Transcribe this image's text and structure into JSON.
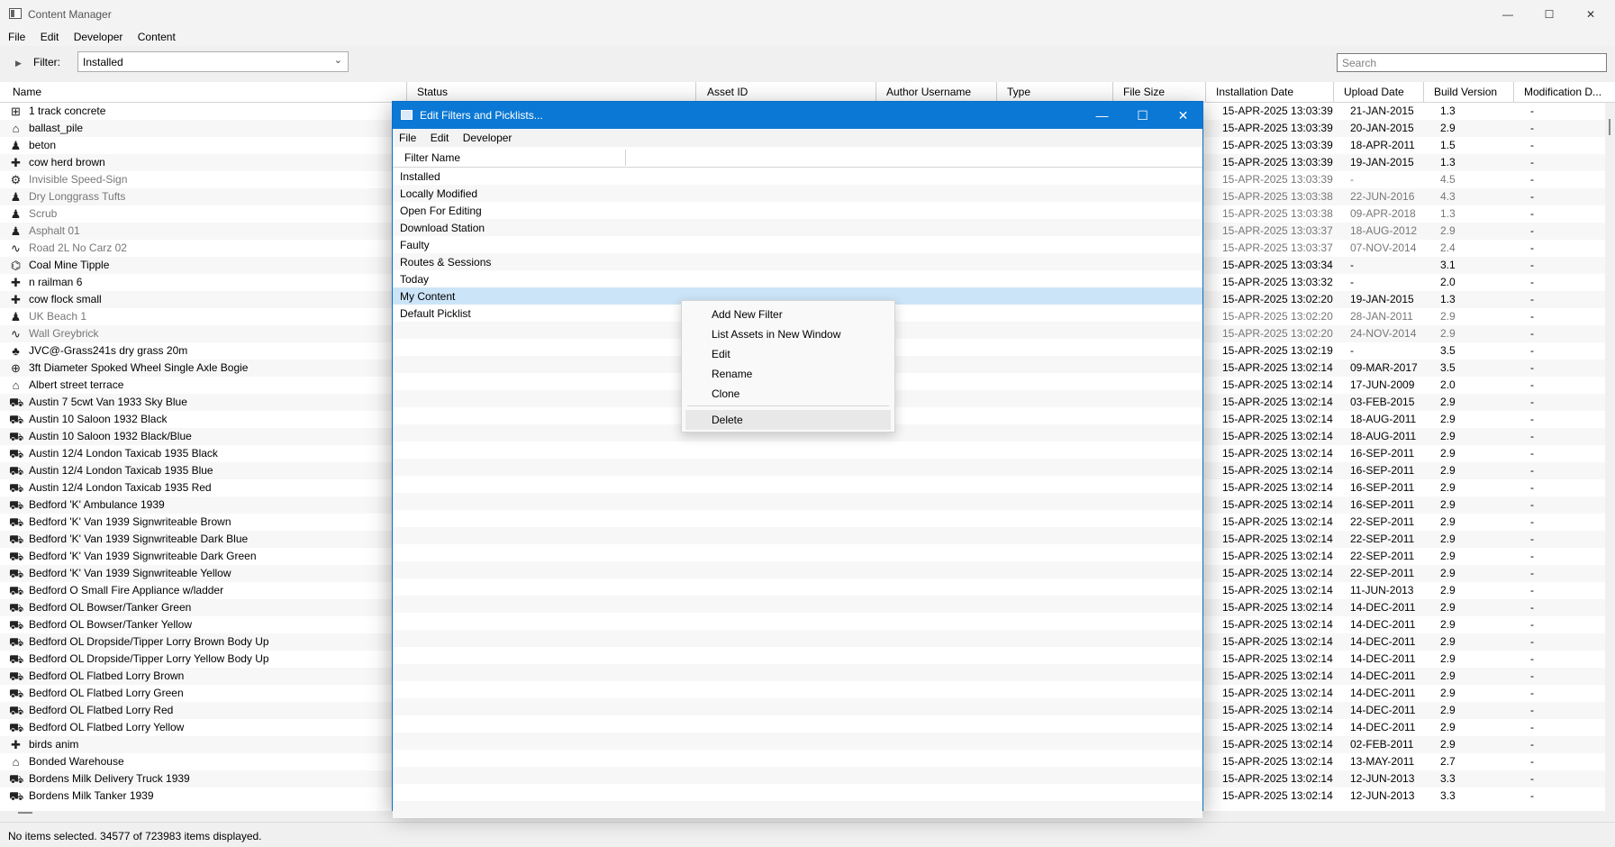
{
  "window": {
    "title": "Content Manager",
    "minimize_glyph": "—",
    "maximize_glyph": "☐",
    "close_glyph": "✕"
  },
  "menu": [
    "File",
    "Edit",
    "Developer",
    "Content"
  ],
  "filter": {
    "expander_glyph": "▶",
    "label": "Filter:",
    "value": "Installed",
    "chevron_glyph": "⌄"
  },
  "search": {
    "placeholder": "Search"
  },
  "columns": [
    "Name",
    "Status",
    "Asset ID",
    "Author Username",
    "Type",
    "File Size",
    "Installation Date",
    "Upload Date",
    "Build Version",
    "Modification D..."
  ],
  "rows": [
    {
      "icon": "track-icon",
      "glyph": "⊞",
      "name": "1 track concrete",
      "inst": "15-APR-2025 13:03:39",
      "upload": "21-JAN-2015",
      "build": "1.3",
      "mod": "-",
      "gray": false
    },
    {
      "icon": "house-icon",
      "glyph": "⌂",
      "name": "ballast_pile",
      "inst": "15-APR-2025 13:03:39",
      "upload": "20-JAN-2015",
      "build": "2.9",
      "mod": "-",
      "gray": false
    },
    {
      "icon": "figure-icon",
      "glyph": "♟",
      "name": "beton",
      "inst": "15-APR-2025 13:03:39",
      "upload": "18-APR-2011",
      "build": "1.5",
      "mod": "-",
      "gray": false
    },
    {
      "icon": "puzzle-icon",
      "glyph": "✚",
      "name": "cow herd brown",
      "inst": "15-APR-2025 13:03:39",
      "upload": "19-JAN-2015",
      "build": "1.3",
      "mod": "-",
      "gray": false
    },
    {
      "icon": "gear-icon",
      "glyph": "⚙",
      "name": "Invisible Speed-Sign",
      "inst": "15-APR-2025 13:03:39",
      "upload": "-",
      "build": "4.5",
      "mod": "-",
      "gray": true
    },
    {
      "icon": "figure-icon",
      "glyph": "♟",
      "name": "Dry Longgrass Tufts",
      "inst": "15-APR-2025 13:03:38",
      "upload": "22-JUN-2016",
      "build": "4.3",
      "mod": "-",
      "gray": true
    },
    {
      "icon": "figure-icon",
      "glyph": "♟",
      "name": "Scrub",
      "inst": "15-APR-2025 13:03:38",
      "upload": "09-APR-2018",
      "build": "1.3",
      "mod": "-",
      "gray": true
    },
    {
      "icon": "figure-icon",
      "glyph": "♟",
      "name": "Asphalt 01",
      "inst": "15-APR-2025 13:03:37",
      "upload": "18-AUG-2012",
      "build": "2.9",
      "mod": "-",
      "gray": true
    },
    {
      "icon": "spline-icon",
      "glyph": "∿",
      "name": "Road 2L No Carz 02",
      "inst": "15-APR-2025 13:03:37",
      "upload": "07-NOV-2014",
      "build": "2.4",
      "mod": "-",
      "gray": true
    },
    {
      "icon": "industry-icon",
      "glyph": "⌬",
      "name": "Coal Mine Tipple",
      "inst": "15-APR-2025 13:03:34",
      "upload": "-",
      "build": "3.1",
      "mod": "-",
      "gray": false
    },
    {
      "icon": "puzzle-icon",
      "glyph": "✚",
      "name": "n railman 6",
      "inst": "15-APR-2025 13:03:32",
      "upload": "-",
      "build": "2.0",
      "mod": "-",
      "gray": false
    },
    {
      "icon": "puzzle-icon",
      "glyph": "✚",
      "name": "cow flock small",
      "inst": "15-APR-2025 13:02:20",
      "upload": "19-JAN-2015",
      "build": "1.3",
      "mod": "-",
      "gray": false
    },
    {
      "icon": "figure-icon",
      "glyph": "♟",
      "name": "UK Beach 1",
      "inst": "15-APR-2025 13:02:20",
      "upload": "28-JAN-2011",
      "build": "2.9",
      "mod": "-",
      "gray": true
    },
    {
      "icon": "spline-icon",
      "glyph": "∿",
      "name": "Wall Greybrick",
      "inst": "15-APR-2025 13:02:20",
      "upload": "24-NOV-2014",
      "build": "2.9",
      "mod": "-",
      "gray": true
    },
    {
      "icon": "tree-icon",
      "glyph": "♣",
      "name": "JVC@-Grass241s dry grass 20m",
      "inst": "15-APR-2025 13:02:19",
      "upload": "-",
      "build": "3.5",
      "mod": "-",
      "gray": false
    },
    {
      "icon": "bogey-icon",
      "glyph": "⊕",
      "name": "3ft Diameter Spoked Wheel Single Axle Bogie",
      "inst": "15-APR-2025 13:02:14",
      "upload": "09-MAR-2017",
      "build": "3.5",
      "mod": "-",
      "gray": false
    },
    {
      "icon": "house-icon",
      "glyph": "⌂",
      "name": "Albert street terrace",
      "inst": "15-APR-2025 13:02:14",
      "upload": "17-JUN-2009",
      "build": "2.0",
      "mod": "-",
      "gray": false
    },
    {
      "icon": "car-icon",
      "glyph": "⛟",
      "name": "Austin 7 5cwt Van 1933 Sky Blue",
      "inst": "15-APR-2025 13:02:14",
      "upload": "03-FEB-2015",
      "build": "2.9",
      "mod": "-",
      "gray": false
    },
    {
      "icon": "car-icon",
      "glyph": "⛟",
      "name": "Austin 10 Saloon 1932 Black",
      "inst": "15-APR-2025 13:02:14",
      "upload": "18-AUG-2011",
      "build": "2.9",
      "mod": "-",
      "gray": false
    },
    {
      "icon": "car-icon",
      "glyph": "⛟",
      "name": "Austin 10 Saloon 1932 Black/Blue",
      "inst": "15-APR-2025 13:02:14",
      "upload": "18-AUG-2011",
      "build": "2.9",
      "mod": "-",
      "gray": false
    },
    {
      "icon": "car-icon",
      "glyph": "⛟",
      "name": "Austin 12/4 London Taxicab 1935 Black",
      "inst": "15-APR-2025 13:02:14",
      "upload": "16-SEP-2011",
      "build": "2.9",
      "mod": "-",
      "gray": false
    },
    {
      "icon": "car-icon",
      "glyph": "⛟",
      "name": "Austin 12/4 London Taxicab 1935 Blue",
      "inst": "15-APR-2025 13:02:14",
      "upload": "16-SEP-2011",
      "build": "2.9",
      "mod": "-",
      "gray": false
    },
    {
      "icon": "car-icon",
      "glyph": "⛟",
      "name": "Austin 12/4 London Taxicab 1935 Red",
      "inst": "15-APR-2025 13:02:14",
      "upload": "16-SEP-2011",
      "build": "2.9",
      "mod": "-",
      "gray": false
    },
    {
      "icon": "car-icon",
      "glyph": "⛟",
      "name": "Bedford 'K' Ambulance 1939",
      "inst": "15-APR-2025 13:02:14",
      "upload": "16-SEP-2011",
      "build": "2.9",
      "mod": "-",
      "gray": false
    },
    {
      "icon": "car-icon",
      "glyph": "⛟",
      "name": "Bedford 'K' Van 1939 Signwriteable Brown",
      "inst": "15-APR-2025 13:02:14",
      "upload": "22-SEP-2011",
      "build": "2.9",
      "mod": "-",
      "gray": false
    },
    {
      "icon": "car-icon",
      "glyph": "⛟",
      "name": "Bedford 'K' Van 1939 Signwriteable Dark Blue",
      "inst": "15-APR-2025 13:02:14",
      "upload": "22-SEP-2011",
      "build": "2.9",
      "mod": "-",
      "gray": false
    },
    {
      "icon": "car-icon",
      "glyph": "⛟",
      "name": "Bedford 'K' Van 1939 Signwriteable Dark Green",
      "inst": "15-APR-2025 13:02:14",
      "upload": "22-SEP-2011",
      "build": "2.9",
      "mod": "-",
      "gray": false
    },
    {
      "icon": "car-icon",
      "glyph": "⛟",
      "name": "Bedford 'K' Van 1939 Signwriteable Yellow",
      "inst": "15-APR-2025 13:02:14",
      "upload": "22-SEP-2011",
      "build": "2.9",
      "mod": "-",
      "gray": false
    },
    {
      "icon": "car-icon",
      "glyph": "⛟",
      "name": "Bedford O Small Fire Appliance w/ladder",
      "inst": "15-APR-2025 13:02:14",
      "upload": "11-JUN-2013",
      "build": "2.9",
      "mod": "-",
      "gray": false
    },
    {
      "icon": "car-icon",
      "glyph": "⛟",
      "name": "Bedford OL Bowser/Tanker Green",
      "inst": "15-APR-2025 13:02:14",
      "upload": "14-DEC-2011",
      "build": "2.9",
      "mod": "-",
      "gray": false
    },
    {
      "icon": "car-icon",
      "glyph": "⛟",
      "name": "Bedford OL Bowser/Tanker Yellow",
      "inst": "15-APR-2025 13:02:14",
      "upload": "14-DEC-2011",
      "build": "2.9",
      "mod": "-",
      "gray": false
    },
    {
      "icon": "car-icon",
      "glyph": "⛟",
      "name": "Bedford OL Dropside/Tipper Lorry Brown Body Up",
      "inst": "15-APR-2025 13:02:14",
      "upload": "14-DEC-2011",
      "build": "2.9",
      "mod": "-",
      "gray": false
    },
    {
      "icon": "car-icon",
      "glyph": "⛟",
      "name": "Bedford OL Dropside/Tipper Lorry Yellow Body Up",
      "inst": "15-APR-2025 13:02:14",
      "upload": "14-DEC-2011",
      "build": "2.9",
      "mod": "-",
      "gray": false
    },
    {
      "icon": "car-icon",
      "glyph": "⛟",
      "name": "Bedford OL Flatbed Lorry Brown",
      "inst": "15-APR-2025 13:02:14",
      "upload": "14-DEC-2011",
      "build": "2.9",
      "mod": "-",
      "gray": false
    },
    {
      "icon": "car-icon",
      "glyph": "⛟",
      "name": "Bedford OL Flatbed Lorry Green",
      "inst": "15-APR-2025 13:02:14",
      "upload": "14-DEC-2011",
      "build": "2.9",
      "mod": "-",
      "gray": false
    },
    {
      "icon": "car-icon",
      "glyph": "⛟",
      "name": "Bedford OL Flatbed Lorry Red",
      "inst": "15-APR-2025 13:02:14",
      "upload": "14-DEC-2011",
      "build": "2.9",
      "mod": "-",
      "gray": false
    },
    {
      "icon": "car-icon",
      "glyph": "⛟",
      "name": "Bedford OL Flatbed Lorry Yellow",
      "inst": "15-APR-2025 13:02:14",
      "upload": "14-DEC-2011",
      "build": "2.9",
      "mod": "-",
      "gray": false
    },
    {
      "icon": "puzzle-icon",
      "glyph": "✚",
      "name": "birds anim",
      "inst": "15-APR-2025 13:02:14",
      "upload": "02-FEB-2011",
      "build": "2.9",
      "mod": "-",
      "gray": false
    },
    {
      "icon": "house-icon",
      "glyph": "⌂",
      "name": "Bonded Warehouse",
      "inst": "15-APR-2025 13:02:14",
      "upload": "13-MAY-2011",
      "build": "2.7",
      "mod": "-",
      "gray": false
    },
    {
      "icon": "car-icon",
      "glyph": "⛟",
      "name": "Bordens Milk Delivery Truck 1939",
      "inst": "15-APR-2025 13:02:14",
      "upload": "12-JUN-2013",
      "build": "3.3",
      "mod": "-",
      "gray": false
    },
    {
      "icon": "car-icon",
      "glyph": "⛟",
      "name": "Bordens Milk Tanker 1939",
      "inst": "15-APR-2025 13:02:14",
      "upload": "12-JUN-2013",
      "build": "3.3",
      "mod": "-",
      "gray": false
    }
  ],
  "status": "No items selected. 34577 of 723983 items displayed.",
  "dialog": {
    "title": "Edit Filters and Picklists...",
    "menu": [
      "File",
      "Edit",
      "Developer"
    ],
    "column": "Filter Name",
    "filters": [
      "Installed",
      "Locally Modified",
      "Open For Editing",
      "Download Station",
      "Faulty",
      "Routes & Sessions",
      "Today",
      "My Content",
      "Default Picklist"
    ],
    "selected_filter": "My Content"
  },
  "context_menu": {
    "items": [
      "Add New Filter",
      "List Assets in New Window",
      "Edit",
      "Rename",
      "Clone"
    ],
    "delete_label": "Delete"
  },
  "colors": {
    "accent": "#0a78d4",
    "selection": "#cce4f7"
  }
}
